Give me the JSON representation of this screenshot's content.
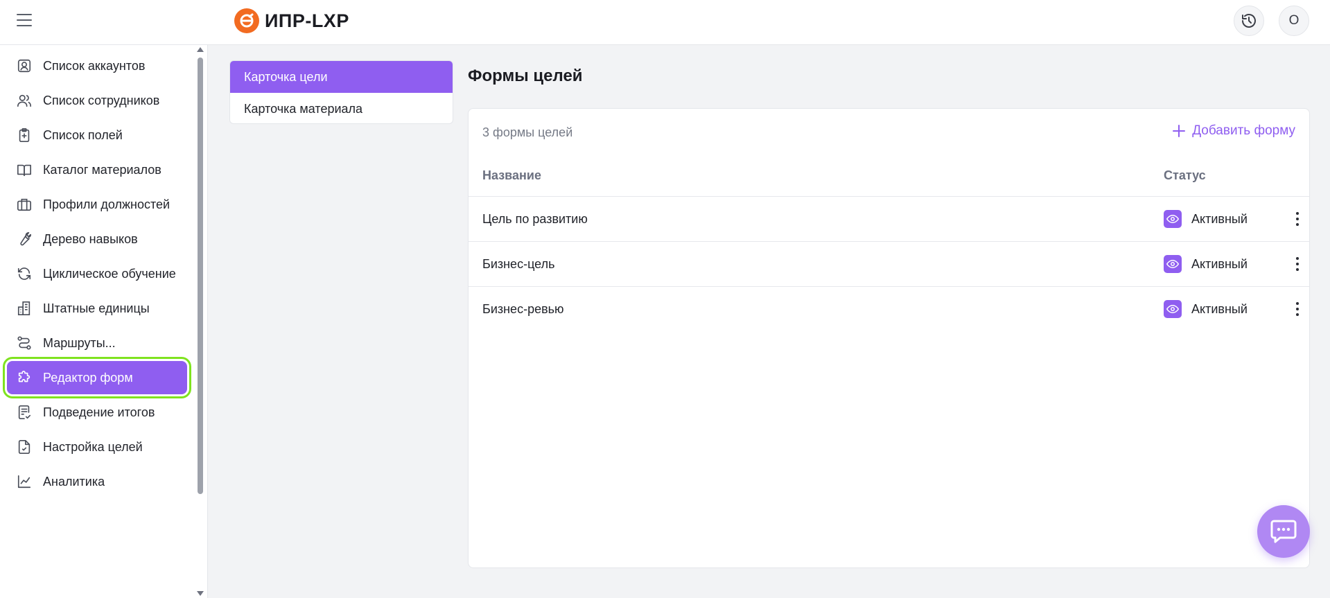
{
  "app": {
    "logo_text": "ИПР-LXP",
    "avatar_initial": "О",
    "colors": {
      "accent": "#8f5ef0",
      "logo": "#f26b21",
      "highlight": "#7fe31f"
    }
  },
  "sidebar": {
    "items": [
      {
        "label": "Список аккаунтов",
        "icon": "account-icon"
      },
      {
        "label": "Список сотрудников",
        "icon": "users-icon"
      },
      {
        "label": "Список полей",
        "icon": "clipboard-plus-icon"
      },
      {
        "label": "Каталог материалов",
        "icon": "book-icon"
      },
      {
        "label": "Профили должностей",
        "icon": "briefcase-icon"
      },
      {
        "label": "Дерево навыков",
        "icon": "wrench-icon"
      },
      {
        "label": "Циклическое обучение",
        "icon": "refresh-icon"
      },
      {
        "label": "Штатные единицы",
        "icon": "building-icon"
      },
      {
        "label": "Маршруты...",
        "icon": "route-icon"
      },
      {
        "label": "Редактор форм",
        "icon": "puzzle-icon",
        "active": true
      },
      {
        "label": "Подведение итогов",
        "icon": "checklist-icon"
      },
      {
        "label": "Настройка целей",
        "icon": "file-check-icon"
      },
      {
        "label": "Аналитика",
        "icon": "chart-line-icon"
      }
    ]
  },
  "form_types": {
    "items": [
      {
        "label": "Карточка цели",
        "active": true
      },
      {
        "label": "Карточка материала",
        "active": false
      }
    ]
  },
  "main": {
    "title": "Формы целей",
    "count_text": "3 формы целей",
    "add_label": "Добавить форму",
    "columns": {
      "name": "Название",
      "status": "Статус"
    },
    "rows": [
      {
        "name": "Цель по развитию",
        "status": "Активный"
      },
      {
        "name": "Бизнес-цель",
        "status": "Активный"
      },
      {
        "name": "Бизнес-ревью",
        "status": "Активный"
      }
    ]
  }
}
